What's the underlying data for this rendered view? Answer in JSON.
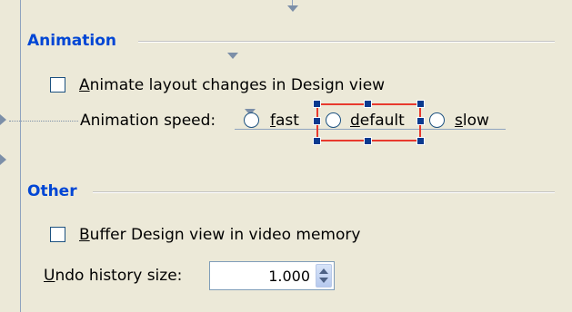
{
  "animation_section": {
    "title": "Animation",
    "animate_checkbox": {
      "checked": false,
      "label_mnemonic": "A",
      "label_rest": "nimate layout changes in Design view"
    },
    "speed": {
      "label": "Animation speed:",
      "options": [
        {
          "mnemonic": "f",
          "rest": "ast",
          "selected": false
        },
        {
          "mnemonic": "d",
          "rest": "efault",
          "selected": false
        },
        {
          "mnemonic": "s",
          "rest": "low",
          "selected": false
        }
      ]
    }
  },
  "other_section": {
    "title": "Other",
    "buffer_checkbox": {
      "checked": false,
      "label_mnemonic": "B",
      "label_rest": "uffer Design view in video memory"
    },
    "undo": {
      "label_mnemonic": "U",
      "label_rest": "ndo history size:",
      "value": "1.000"
    }
  },
  "icons": [
    "anchor-marker-icon",
    "spin-up-arrow-icon",
    "spin-down-arrow-icon"
  ],
  "colors": {
    "background": "#ece9d8",
    "section_title": "#0046d5",
    "selection_red": "#e83a2e",
    "handle_blue": "#0a3a8f",
    "control_border": "#1c5180"
  }
}
